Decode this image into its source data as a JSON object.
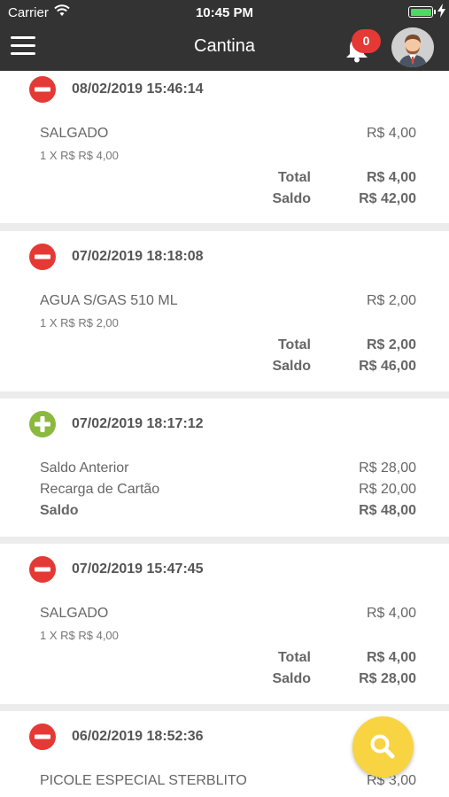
{
  "status_bar": {
    "carrier": "Carrier",
    "time": "10:45 PM"
  },
  "header": {
    "title": "Cantina",
    "notification_count": "0"
  },
  "transactions": [
    {
      "type": "debit",
      "date": "08/02/2019 15:46:14",
      "item": "SALGADO",
      "item_price": "R$ 4,00",
      "detail": "1 X R$ R$ 4,00",
      "total_label": "Total",
      "total_value": "R$ 4,00",
      "balance_label": "Saldo",
      "balance_value": "R$ 42,00"
    },
    {
      "type": "debit",
      "date": "07/02/2019 18:18:08",
      "item": "AGUA S/GAS 510 ML",
      "item_price": "R$ 2,00",
      "detail": "1 X R$ R$ 2,00",
      "total_label": "Total",
      "total_value": "R$ 2,00",
      "balance_label": "Saldo",
      "balance_value": "R$ 46,00"
    },
    {
      "type": "credit",
      "date": "07/02/2019 18:17:12",
      "previous_label": "Saldo Anterior",
      "previous_value": "R$ 28,00",
      "recharge_label": "Recarga de Cartão",
      "recharge_value": "R$ 20,00",
      "balance_label": "Saldo",
      "balance_value": "R$ 48,00"
    },
    {
      "type": "debit",
      "date": "07/02/2019 15:47:45",
      "item": "SALGADO",
      "item_price": "R$ 4,00",
      "detail": "1 X R$ R$ 4,00",
      "total_label": "Total",
      "total_value": "R$ 4,00",
      "balance_label": "Saldo",
      "balance_value": "R$ 28,00"
    },
    {
      "type": "debit",
      "date": "06/02/2019 18:52:36",
      "item": "PICOLE ESPECIAL STERBLITO",
      "item_price": "R$ 3,00"
    }
  ],
  "icons": {
    "menu": "hamburger-menu-icon",
    "bell": "bell-icon",
    "avatar": "user-avatar",
    "debit": "minus-circle-icon",
    "credit": "plus-circle-icon",
    "search": "search-icon"
  },
  "colors": {
    "header": "#333333",
    "debit": "#e53935",
    "credit": "#8bb83f",
    "fab": "#f8d442",
    "badge": "#e53935"
  }
}
